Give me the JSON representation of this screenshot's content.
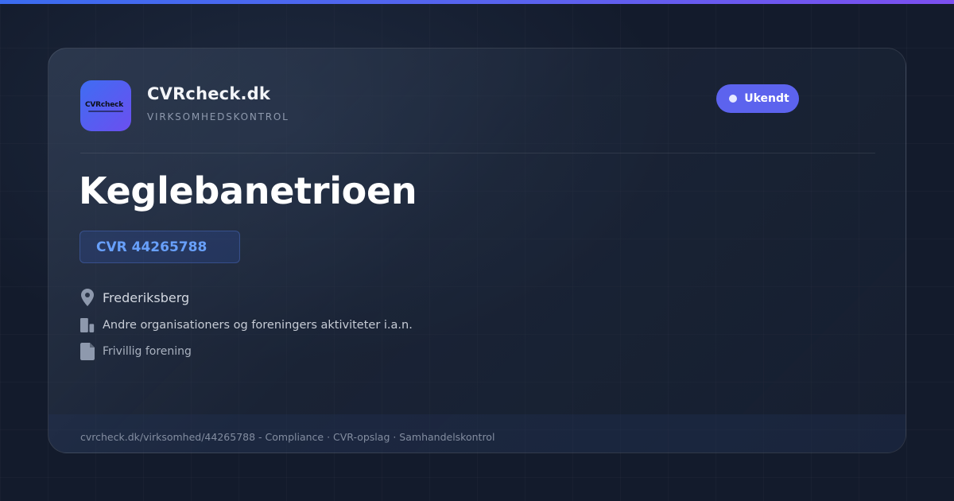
{
  "brand": {
    "logo_text": "CVRcheck",
    "name": "CVRcheck.dk",
    "tagline": "VIRKSOMHEDSKONTROL",
    "accent_color": "#5c63ee"
  },
  "status": {
    "label": "Ukendt",
    "color": "#5c63ee"
  },
  "company": {
    "name": "Keglebanetrioen",
    "cvr_label": "CVR 44265788"
  },
  "details": {
    "location": {
      "icon": "location-pin-icon",
      "text": "Frederiksberg"
    },
    "industry": {
      "icon": "building-icon",
      "text": "Andre organisationers og foreningers aktiviteter i.a.n."
    },
    "legal_form": {
      "icon": "document-icon",
      "text": "Frivillig forening"
    }
  },
  "footer": {
    "text": "cvrcheck.dk/virksomhed/44265788 - Compliance · CVR-opslag · Samhandelskontrol"
  }
}
